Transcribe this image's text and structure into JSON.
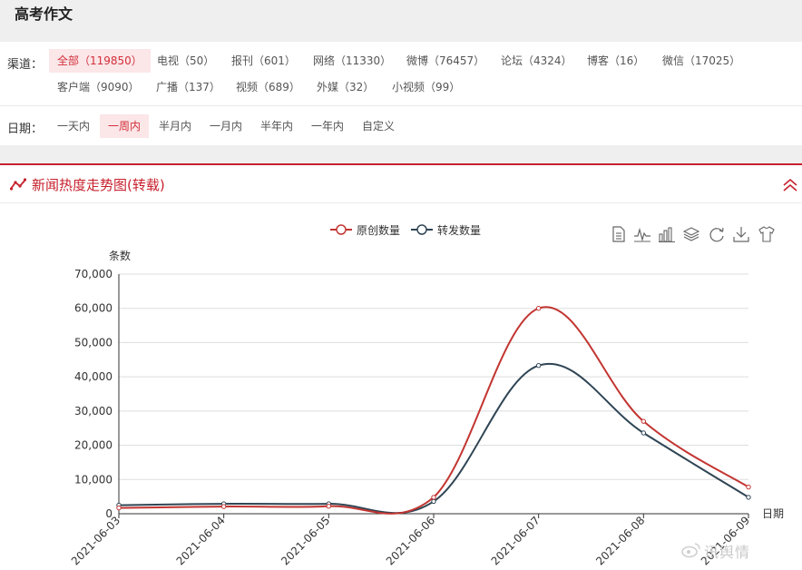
{
  "page": {
    "title": "高考作文"
  },
  "filters": {
    "channel_label": "渠道：",
    "channels": [
      {
        "label": "全部（119850）",
        "active": true
      },
      {
        "label": "电视（50）",
        "active": false
      },
      {
        "label": "报刊（601）",
        "active": false
      },
      {
        "label": "网络（11330）",
        "active": false
      },
      {
        "label": "微博（76457）",
        "active": false
      },
      {
        "label": "论坛（4324）",
        "active": false
      },
      {
        "label": "博客（16）",
        "active": false
      },
      {
        "label": "微信（17025）",
        "active": false
      },
      {
        "label": "客户端（9090）",
        "active": false
      },
      {
        "label": "广播（137）",
        "active": false
      },
      {
        "label": "视频（689）",
        "active": false
      },
      {
        "label": "外媒（32）",
        "active": false
      },
      {
        "label": "小视频（99）",
        "active": false
      }
    ],
    "date_label": "日期：",
    "dates": [
      {
        "label": "一天内",
        "active": false
      },
      {
        "label": "一周内",
        "active": true
      },
      {
        "label": "半月内",
        "active": false
      },
      {
        "label": "一月内",
        "active": false
      },
      {
        "label": "半年内",
        "active": false
      },
      {
        "label": "一年内",
        "active": false
      },
      {
        "label": "自定义",
        "active": false
      }
    ]
  },
  "panel": {
    "title": "新闻热度走势图(转载)"
  },
  "toolbox": [
    "data-view-icon",
    "line-chart-icon",
    "bar-chart-icon",
    "stack-icon",
    "restore-icon",
    "download-icon",
    "theme-icon"
  ],
  "watermark": "讯舆情",
  "colors": {
    "accent": "#c7202c",
    "series_original": "#c23531",
    "series_repost": "#2f4554",
    "active_chip_bg": "#fbe6e8"
  },
  "chart_data": {
    "type": "line",
    "smooth": true,
    "ylabel": "条数",
    "xlabel": "日期",
    "ylim": [
      0,
      70000
    ],
    "yticks": [
      0,
      10000,
      20000,
      30000,
      40000,
      50000,
      60000,
      70000
    ],
    "ytick_labels": [
      "0",
      "10,000",
      "20,000",
      "30,000",
      "40,000",
      "50,000",
      "60,000",
      "70,000"
    ],
    "categories": [
      "2021-06-03",
      "2021-06-04",
      "2021-06-05",
      "2021-06-06",
      "2021-06-07",
      "2021-06-08",
      "2021-06-09"
    ],
    "series": [
      {
        "name": "原创数量",
        "values": [
          1700,
          2100,
          2200,
          4800,
          60000,
          27000,
          7800
        ]
      },
      {
        "name": "转发数量",
        "values": [
          2500,
          2900,
          2900,
          3600,
          43300,
          23600,
          4800
        ]
      }
    ],
    "grid": true,
    "legend_position": "top-center"
  }
}
